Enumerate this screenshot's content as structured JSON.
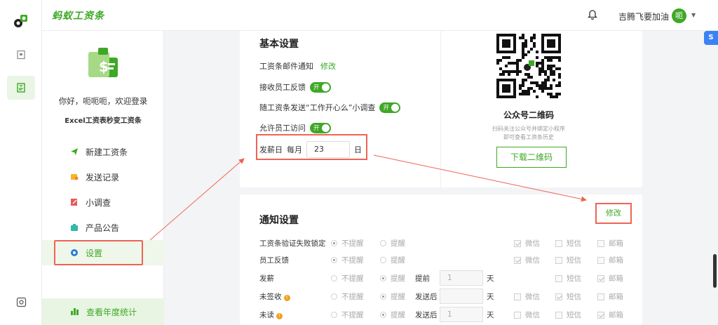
{
  "brand": "蚂蚁工资条",
  "header": {
    "username": "吉腾飞要加油",
    "avatar_char": "呃"
  },
  "sidebar": {
    "welcome": "你好，呃呃呃，欢迎登录",
    "slogan": "Excel工资表秒变工资条",
    "items": [
      {
        "label": "新建工资条",
        "icon": "paper-plane-icon"
      },
      {
        "label": "发送记录",
        "icon": "record-icon"
      },
      {
        "label": "小调查",
        "icon": "survey-icon"
      },
      {
        "label": "产品公告",
        "icon": "announcement-icon"
      },
      {
        "label": "设置",
        "icon": "gear-icon"
      }
    ],
    "stats_label": "查看年度统计"
  },
  "basic": {
    "title": "基本设置",
    "email_notice_label": "工资条邮件通知",
    "email_notice_link": "修改",
    "feedback_label": "接收员工反馈",
    "survey_label": "随工资条发送“工作开心么”小调查",
    "visit_label": "允许员工访问",
    "toggle_text": "开",
    "payday_label": "发薪日",
    "payday_prefix": "每月",
    "payday_value": "23",
    "payday_suffix": "日"
  },
  "qr": {
    "title": "公众号二维码",
    "desc_line1": "扫码关注公众号并绑定小程序",
    "desc_line2": "即可查看工资条历史",
    "download_label": "下载二维码"
  },
  "notify": {
    "title": "通知设置",
    "edit_label": "修改",
    "opt_no": "不提醒",
    "opt_yes": "提醒",
    "ch_wechat": "微信",
    "ch_sms": "短信",
    "ch_email": "邮箱",
    "day_unit": "天",
    "rows": [
      {
        "label": "工资条验证失败锁定",
        "selected": "no",
        "extra_label": "",
        "num": "",
        "wechat": true,
        "sms": false,
        "email": false,
        "warn": false
      },
      {
        "label": "员工反馈",
        "selected": "no",
        "extra_label": "",
        "num": "",
        "wechat": true,
        "sms": false,
        "email": false,
        "warn": false
      },
      {
        "label": "发薪",
        "selected": "yes",
        "extra_label": "提前",
        "num": "1",
        "wechat": null,
        "sms": false,
        "email": true,
        "warn": false
      },
      {
        "label": "未签收",
        "selected": "yes",
        "extra_label": "发送后",
        "num": "",
        "wechat": false,
        "sms": true,
        "email": false,
        "warn": true
      },
      {
        "label": "未读",
        "selected": "yes",
        "extra_label": "发送后",
        "num": "1",
        "wechat": false,
        "sms": false,
        "email": true,
        "warn": true
      }
    ]
  },
  "colors": {
    "accent": "#3ea826",
    "annotation": "#ee6454"
  },
  "float_button": "S"
}
